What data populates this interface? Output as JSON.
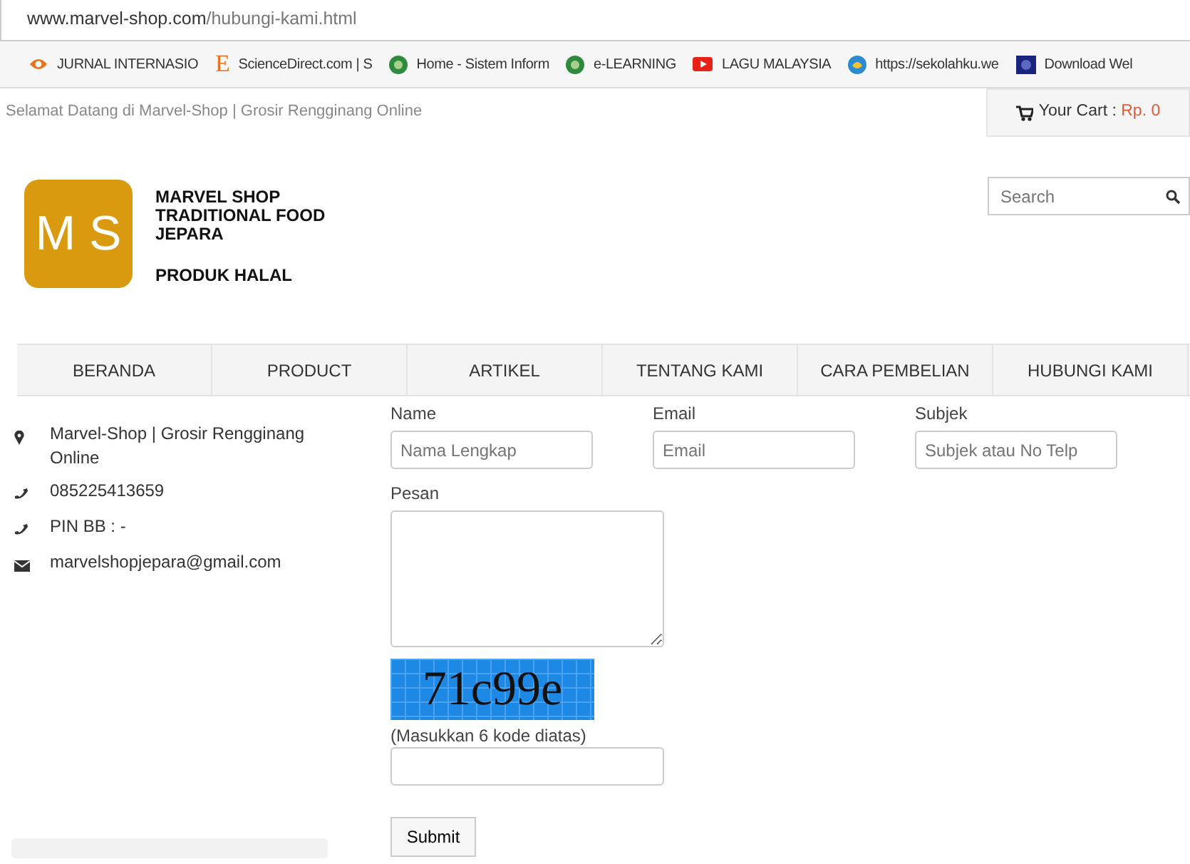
{
  "address_bar": {
    "host": "www.marvel-shop.com",
    "path": "/hubungi-kami.html"
  },
  "bookmarks": [
    {
      "kind": "eye",
      "label": "JURNAL INTERNASIO"
    },
    {
      "kind": "letter",
      "glyph": "E",
      "label": "ScienceDirect.com | S"
    },
    {
      "kind": "green",
      "label": "Home - Sistem Inform"
    },
    {
      "kind": "green",
      "label": "e-LEARNING"
    },
    {
      "kind": "video",
      "label": "LAGU MALAYSIA"
    },
    {
      "kind": "globe",
      "label": "https://sekolahku.we"
    },
    {
      "kind": "dark",
      "label": "Download Wel"
    }
  ],
  "top_bar": {
    "welcome": "Selamat Datang di Marvel-Shop | Grosir Rengginang Online",
    "cart_label": "Your Cart :",
    "cart_value": "Rp. 0"
  },
  "logo": {
    "mark": "M S",
    "lines": [
      "MARVEL SHOP",
      "TRADITIONAL FOOD",
      "JEPARA"
    ],
    "tagline": "PRODUK HALAL"
  },
  "search": {
    "placeholder": "Search"
  },
  "nav": [
    {
      "label": "BERANDA",
      "selected": false
    },
    {
      "label": "PRODUCT",
      "selected": false
    },
    {
      "label": "ARTIKEL",
      "selected": false
    },
    {
      "label": "TENTANG KAMI",
      "selected": false
    },
    {
      "label": "CARA PEMBELIAN",
      "selected": false
    },
    {
      "label": "HUBUNGI KAMI",
      "selected": false
    }
  ],
  "contact": [
    {
      "kind": "location",
      "text": "Marvel-Shop | Grosir Rengginang Online"
    },
    {
      "kind": "phone",
      "text": "085225413659"
    },
    {
      "kind": "phone",
      "text": "PIN BB : -"
    },
    {
      "kind": "mail",
      "text": "marvelshopjepara@gmail.com"
    }
  ],
  "form": {
    "fields": [
      {
        "label": "Name",
        "placeholder": "Nama Lengkap"
      },
      {
        "label": "Email",
        "placeholder": "Email"
      },
      {
        "label": "Subjek",
        "placeholder": "Subjek atau No Telp"
      }
    ],
    "message_label": "Pesan",
    "captcha": "71c99e",
    "captcha_hint": "(Masukkan 6 kode diatas)",
    "submit": "Submit"
  }
}
